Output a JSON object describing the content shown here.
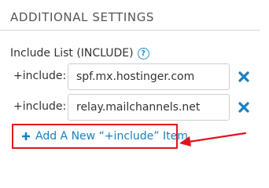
{
  "section": {
    "heading": "ADDITIONAL SETTINGS"
  },
  "include_list": {
    "label": "Include List (INCLUDE)",
    "help_icon_glyph": "?",
    "rows": [
      {
        "label": "+include:",
        "value": "spf.mx.hostinger.com"
      },
      {
        "label": "+include:",
        "value": "relay.mailchannels.net"
      }
    ],
    "add_button_label": "Add A New “+include” Item"
  },
  "colors": {
    "accent_blue": "#1a80bf",
    "annotation_red": "#e0141e",
    "text": "#333333",
    "border": "#cfcfcf"
  },
  "icons": {
    "help": "question-circle-icon",
    "remove": "close-x-icon",
    "add": "plus-icon",
    "annotation": "arrow-icon"
  }
}
